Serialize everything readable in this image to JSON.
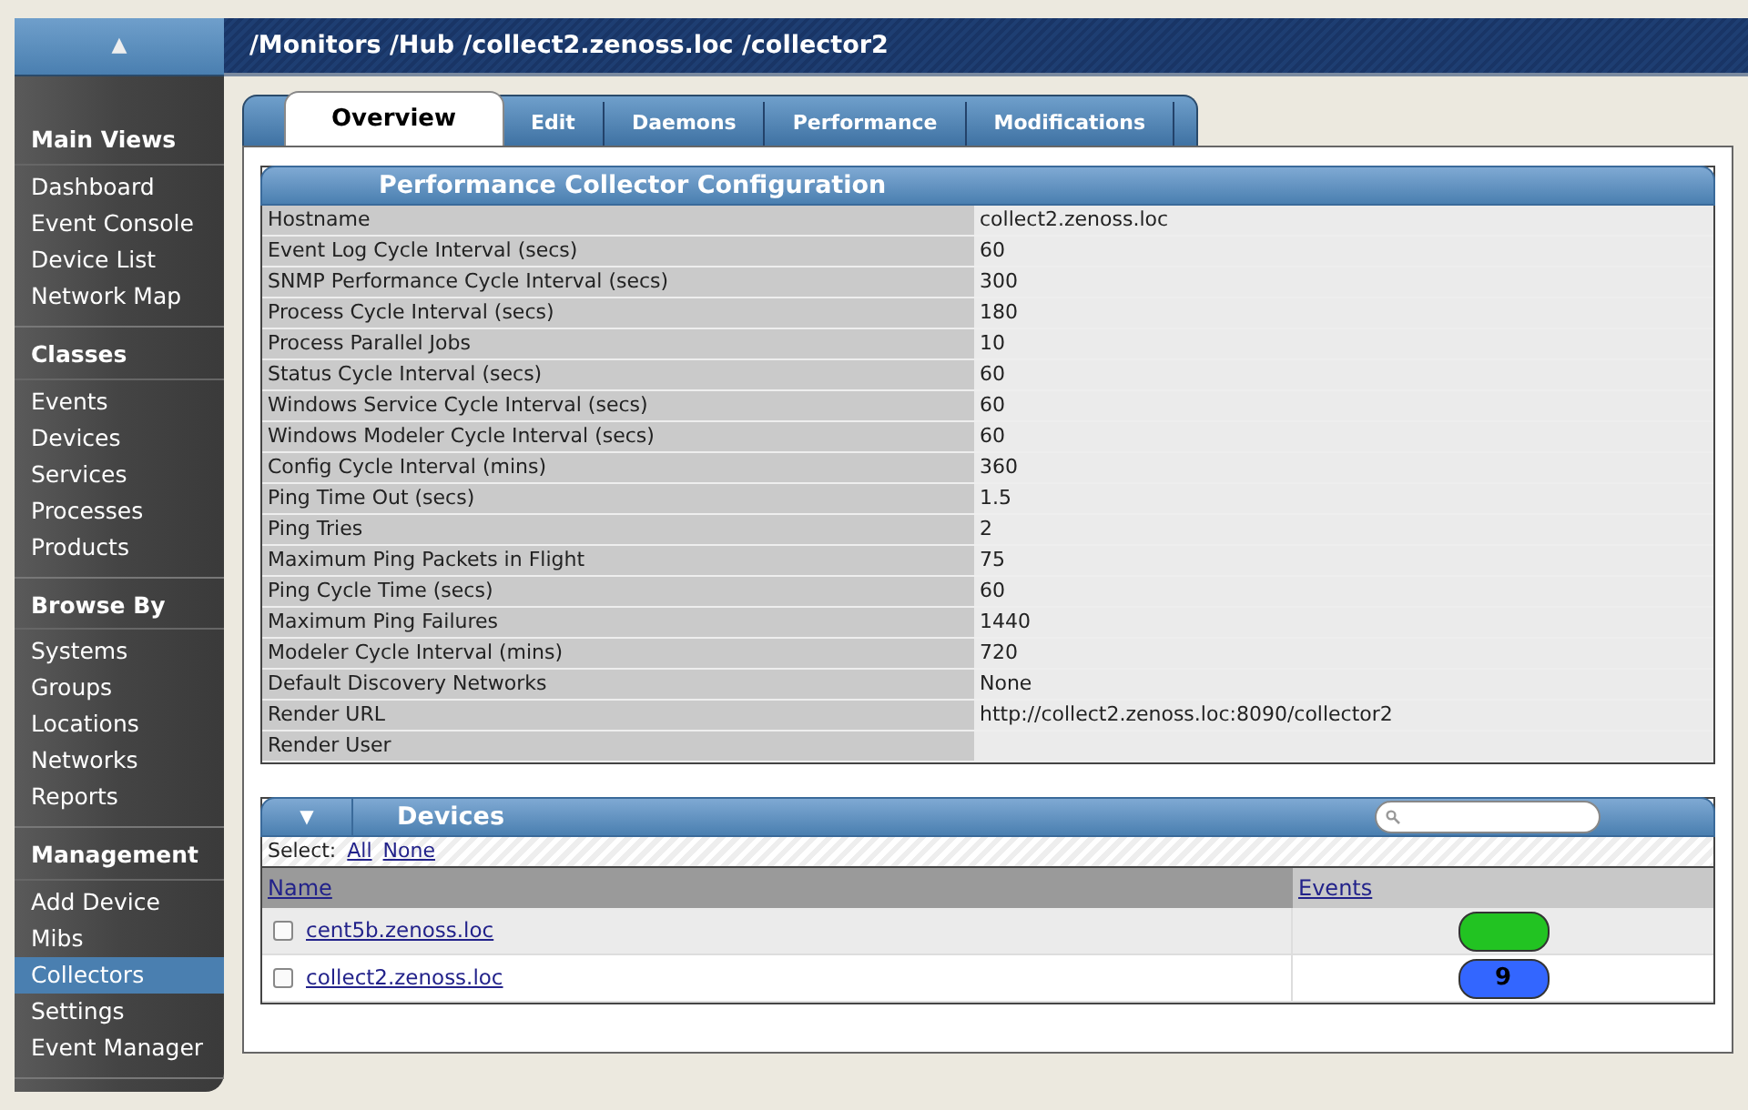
{
  "sidebar": {
    "toggle": "▲",
    "sections": [
      {
        "heading": "Main Views",
        "items": [
          {
            "label": "Dashboard",
            "selected": false
          },
          {
            "label": "Event Console",
            "selected": false
          },
          {
            "label": "Device List",
            "selected": false
          },
          {
            "label": "Network Map",
            "selected": false
          }
        ]
      },
      {
        "heading": "Classes",
        "items": [
          {
            "label": "Events",
            "selected": false
          },
          {
            "label": "Devices",
            "selected": false
          },
          {
            "label": "Services",
            "selected": false
          },
          {
            "label": "Processes",
            "selected": false
          },
          {
            "label": "Products",
            "selected": false
          }
        ]
      },
      {
        "heading": "Browse By",
        "items": [
          {
            "label": "Systems",
            "selected": false
          },
          {
            "label": "Groups",
            "selected": false
          },
          {
            "label": "Locations",
            "selected": false
          },
          {
            "label": "Networks",
            "selected": false
          },
          {
            "label": "Reports",
            "selected": false
          }
        ]
      },
      {
        "heading": "Management",
        "items": [
          {
            "label": "Add Device",
            "selected": false
          },
          {
            "label": "Mibs",
            "selected": false
          },
          {
            "label": "Collectors",
            "selected": true
          },
          {
            "label": "Settings",
            "selected": false
          },
          {
            "label": "Event Manager",
            "selected": false
          }
        ]
      }
    ]
  },
  "breadcrumb": "/Monitors /Hub /collect2.zenoss.loc /collector2",
  "tabs": [
    {
      "label": "Overview",
      "selected": true
    },
    {
      "label": "Edit",
      "selected": false
    },
    {
      "label": "Daemons",
      "selected": false
    },
    {
      "label": "Performance",
      "selected": false
    },
    {
      "label": "Modifications",
      "selected": false
    }
  ],
  "config": {
    "title": "Performance Collector Configuration",
    "rows": [
      {
        "label": "Hostname",
        "value": "collect2.zenoss.loc"
      },
      {
        "label": "Event Log Cycle Interval (secs)",
        "value": "60"
      },
      {
        "label": "SNMP Performance Cycle Interval (secs)",
        "value": "300"
      },
      {
        "label": "Process Cycle Interval (secs)",
        "value": "180"
      },
      {
        "label": "Process Parallel Jobs",
        "value": "10"
      },
      {
        "label": "Status Cycle Interval (secs)",
        "value": "60"
      },
      {
        "label": "Windows Service Cycle Interval (secs)",
        "value": "60"
      },
      {
        "label": "Windows Modeler Cycle Interval (secs)",
        "value": "60"
      },
      {
        "label": "Config Cycle Interval (mins)",
        "value": "360"
      },
      {
        "label": "Ping Time Out (secs)",
        "value": "1.5"
      },
      {
        "label": "Ping Tries",
        "value": "2"
      },
      {
        "label": "Maximum Ping Packets in Flight",
        "value": "75"
      },
      {
        "label": "Ping Cycle Time (secs)",
        "value": "60"
      },
      {
        "label": "Maximum Ping Failures",
        "value": "1440"
      },
      {
        "label": "Modeler Cycle Interval (mins)",
        "value": "720"
      },
      {
        "label": "Default Discovery Networks",
        "value": "None"
      },
      {
        "label": "Render URL",
        "value": "http://collect2.zenoss.loc:8090/collector2"
      },
      {
        "label": "Render User"
      }
    ]
  },
  "devices": {
    "toggle": "▼",
    "title": "Devices",
    "select_label": "Select:",
    "select_links": [
      "All",
      "None"
    ],
    "columns": [
      "Name",
      "Events"
    ],
    "rows": [
      {
        "name": "cent5b.zenoss.loc",
        "checked": false,
        "color": "#22c322"
      },
      {
        "name": "collect2.zenoss.loc",
        "checked": false,
        "events": "9",
        "color": "#3366ff"
      }
    ]
  }
}
